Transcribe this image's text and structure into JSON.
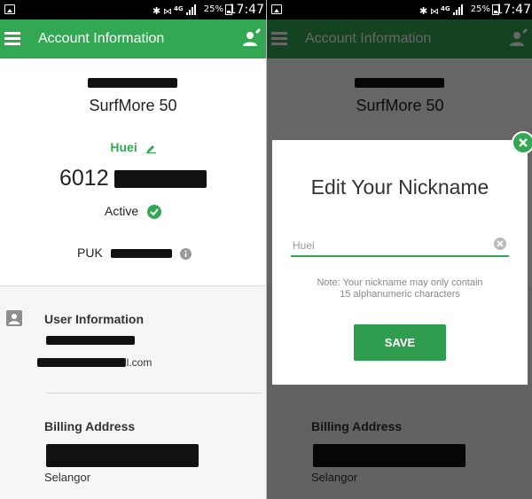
{
  "status_bar": {
    "icons": "✱ & ✶",
    "network": "4G",
    "battery": "25%",
    "time": "17:47"
  },
  "appbar": {
    "title": "Account Information",
    "menu_icon": "hamburger-icon",
    "profile_icon": "person-edit-icon"
  },
  "account": {
    "plan": "SurfMore 50",
    "nickname": "Huei",
    "number_prefix": "6012",
    "status": "Active",
    "puk_label": "PUK"
  },
  "user_info": {
    "title": "User Information",
    "email_suffix": "il.com"
  },
  "billing": {
    "title": "Billing Address",
    "state": "Selangor"
  },
  "dialog": {
    "title": "Edit Your Nickname",
    "input_value": "Huei",
    "note_line1": "Note: Your nickname may only contain",
    "note_line2": "15 alphanumeric characters",
    "save_label": "SAVE"
  },
  "colors": {
    "accent": "#33a853",
    "overlay": "rgba(0,0,0,0.6)"
  }
}
